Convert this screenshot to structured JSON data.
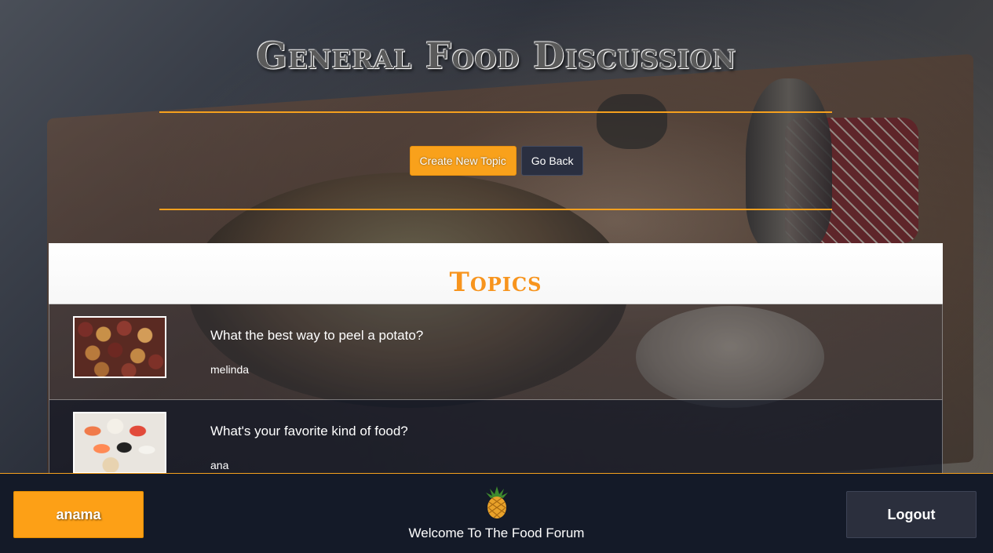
{
  "header": {
    "title": "General Food Discussion",
    "create_button": "Create New Topic",
    "back_button": "Go Back"
  },
  "topics": {
    "heading": "Topics",
    "items": [
      {
        "title": "What the best way to peel a potato?",
        "author": "melinda",
        "image": "potatoes"
      },
      {
        "title": "What's your favorite kind of food?",
        "author": "ana",
        "image": "sushi"
      }
    ]
  },
  "footer": {
    "user_button": "anama",
    "logout_button": "Logout",
    "logo_icon": "pineapple-icon",
    "welcome": "Welcome To The Food Forum"
  },
  "colors": {
    "accent": "#f7941d",
    "footer_bg": "#141a28",
    "dark_button": "#2b2f3d"
  }
}
